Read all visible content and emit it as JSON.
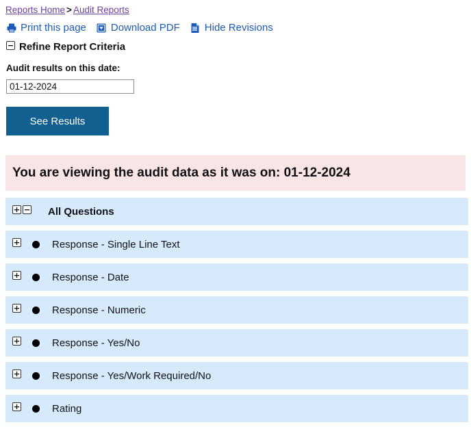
{
  "breadcrumb": {
    "home": "Reports Home",
    "separator": ">",
    "current": "Audit Reports"
  },
  "toolbar": {
    "print": {
      "label": "Print this page",
      "icon": "printer-icon"
    },
    "download": {
      "label": "Download PDF",
      "icon": "download-box-icon"
    },
    "revisions": {
      "label": "Hide Revisions",
      "icon": "document-icon"
    }
  },
  "refine": {
    "title": "Refine Report Criteria",
    "toggle_icon": "minus-box-icon"
  },
  "form": {
    "date_label": "Audit results on this date:",
    "date_value": "01-12-2024",
    "date_placeholder": "dd-mm-yyyy",
    "submit_label": "See Results"
  },
  "notice": {
    "text": "You are viewing the audit data as it was on: 01-12-2024"
  },
  "questions": {
    "header": {
      "label": "All Questions",
      "expand_icon": "plus-box-icon",
      "collapse_icon": "minus-box-icon"
    },
    "items": [
      {
        "label": "Response - Single Line Text"
      },
      {
        "label": "Response - Date"
      },
      {
        "label": "Response - Numeric"
      },
      {
        "label": "Response - Yes/No"
      },
      {
        "label": "Response - Yes/Work Required/No"
      },
      {
        "label": "Rating"
      }
    ]
  },
  "colors": {
    "link": "#1d5bb8",
    "visited_link": "#6b3fa0",
    "button": "#11608f",
    "row": "#d6eafc",
    "notice": "#f8e5e5"
  }
}
